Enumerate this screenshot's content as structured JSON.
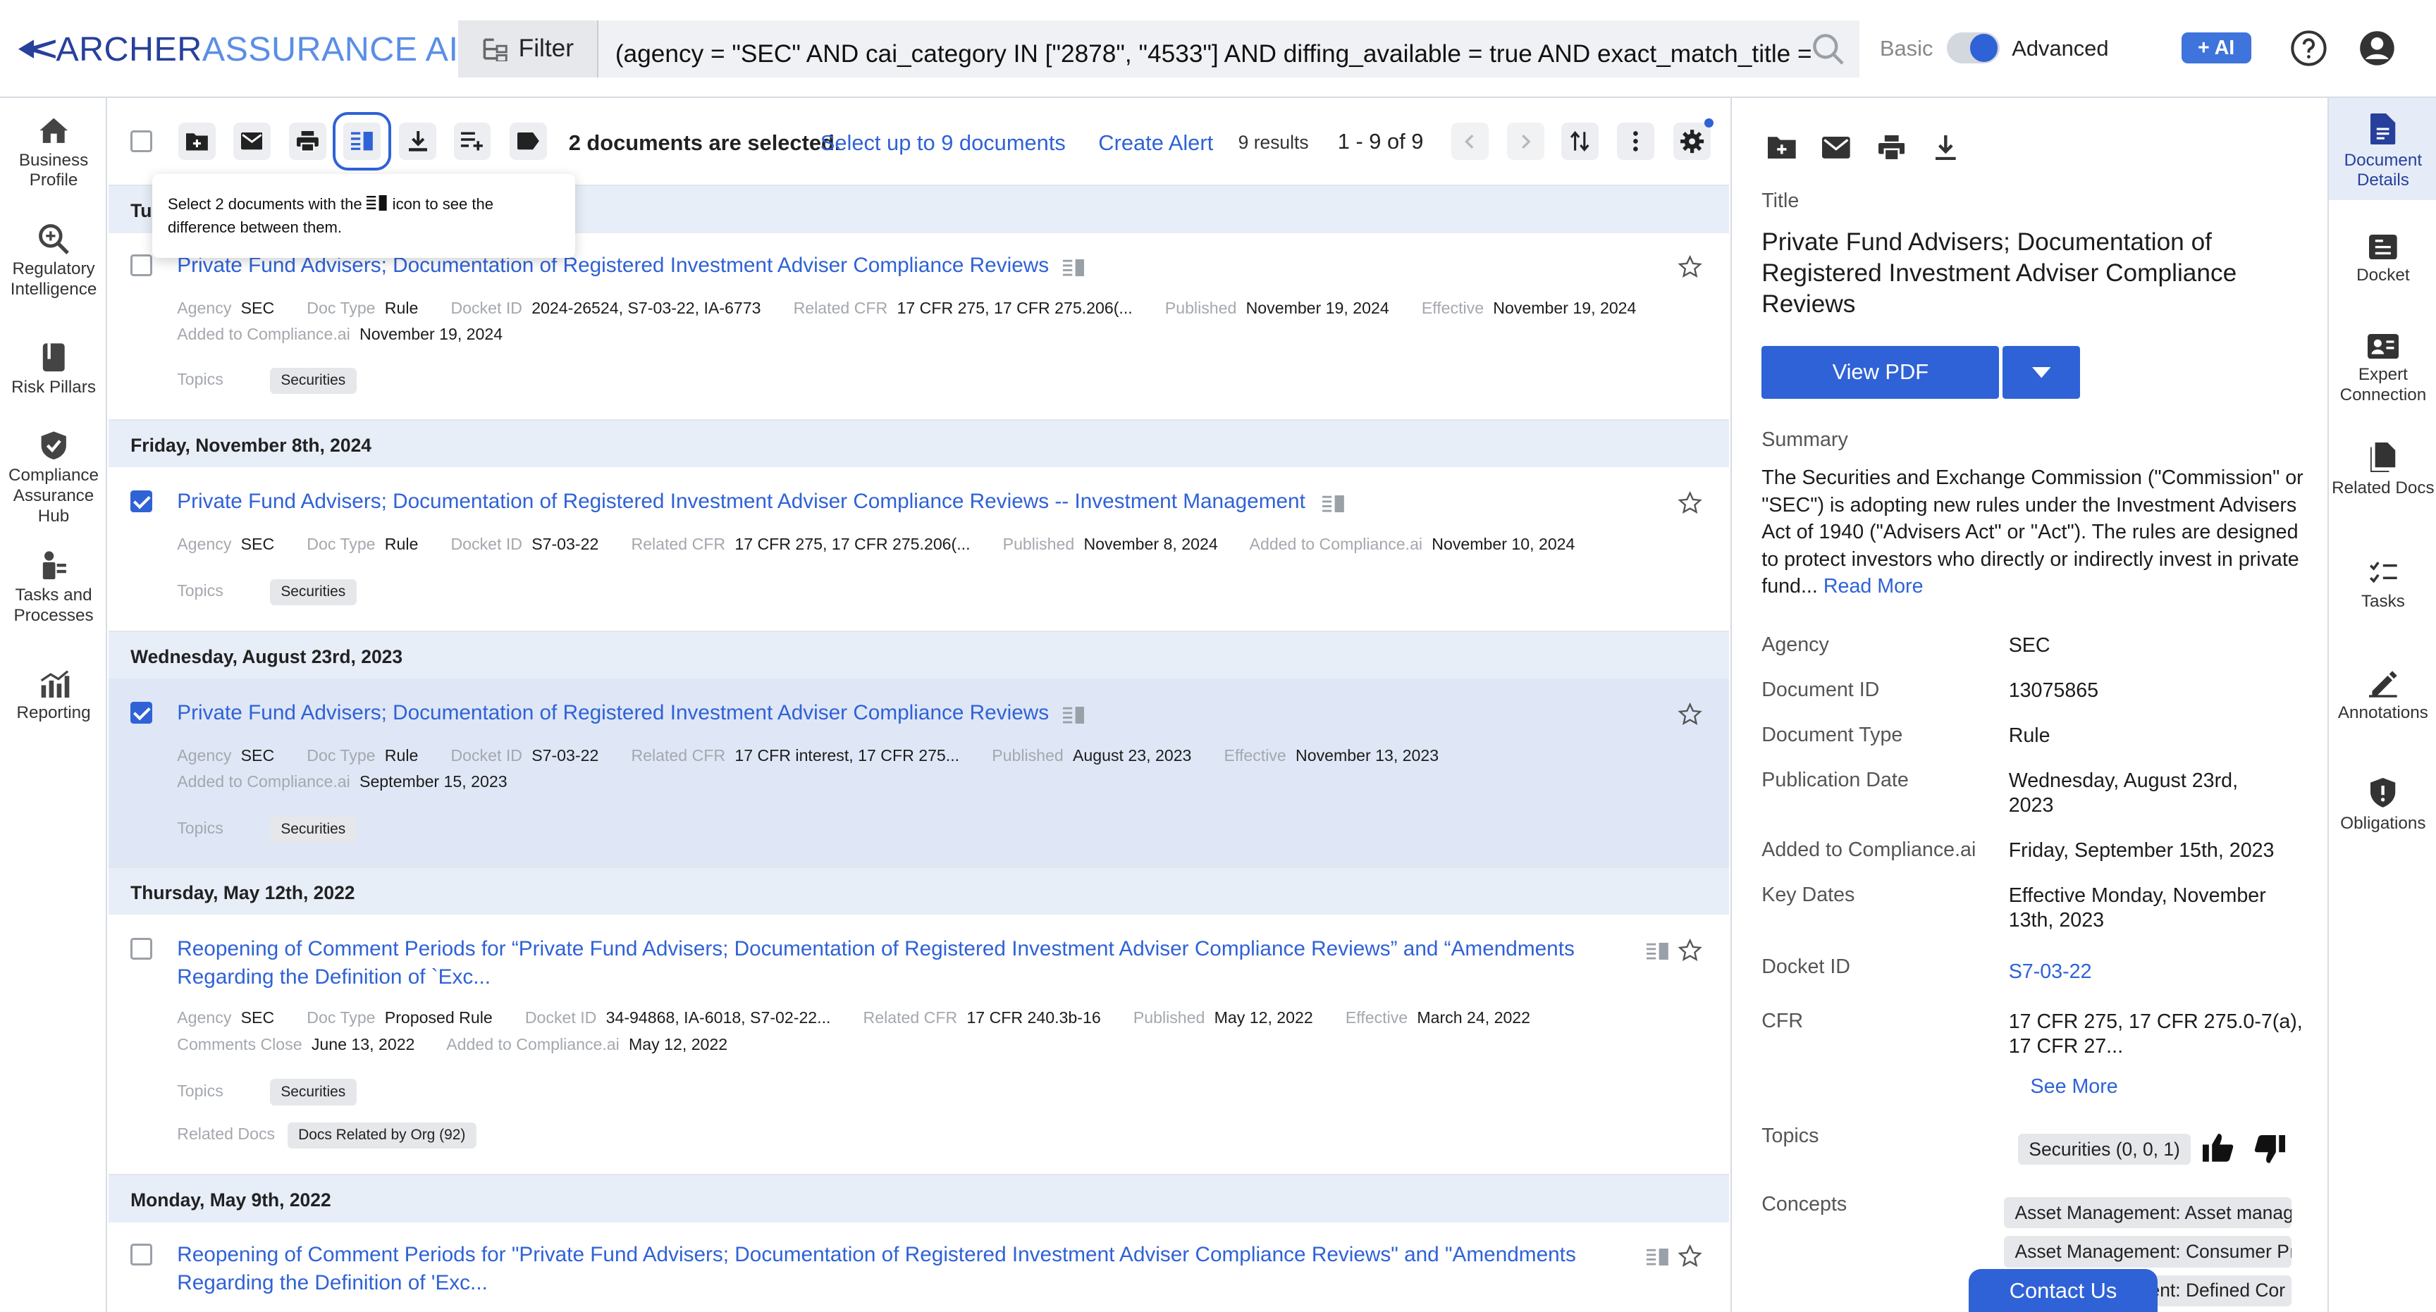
{
  "app": {
    "logo_part1": "ARCHER",
    "logo_part2": "ASSURANCE AI"
  },
  "header": {
    "filter_label": "Filter",
    "query": "(agency = \"SEC\" AND cai_category IN [\"2878\", \"4533\"] AND diffing_available = true AND exact_match_title =",
    "mode_basic": "Basic",
    "mode_advanced": "Advanced",
    "ai_label": "+ AI",
    "advanced_enabled": true
  },
  "leftnav": [
    {
      "label": "Business Profile",
      "icon": "house-icon"
    },
    {
      "label": "Regulatory Intelligence",
      "icon": "magnify-icon"
    },
    {
      "label": "Risk Pillars",
      "icon": "book-icon"
    },
    {
      "label": "Compliance Assurance Hub",
      "icon": "shield-check-icon"
    },
    {
      "label": "Tasks and Processes",
      "icon": "tasks-icon"
    },
    {
      "label": "Reporting",
      "icon": "chart-icon"
    }
  ],
  "toolbar": {
    "selected_text": "2 documents are selected.",
    "select_up_to": "Select up to 9 documents",
    "create_alert": "Create Alert",
    "results": "9 results",
    "range": "1 - 9 of 9"
  },
  "tooltip": {
    "text_before": "Select 2 documents with the",
    "text_after": "icon to see the difference between them."
  },
  "list": {
    "first_date_fragment": "Tu",
    "dates": [
      "Friday, November 8th, 2024",
      "Wednesday, August 23rd, 2023",
      "Thursday, May 12th, 2022",
      "Monday, May 9th, 2022"
    ],
    "docs": [
      {
        "title": "Private Fund Advisers; Documentation of Registered Investment Adviser Compliance Reviews",
        "checked": false,
        "meta1": [
          {
            "k": "Agency",
            "v": "SEC"
          },
          {
            "k": "Doc Type",
            "v": "Rule"
          },
          {
            "k": "Docket ID",
            "v": "2024-26524, S7-03-22, IA-6773"
          },
          {
            "k": "Related CFR",
            "v": "17 CFR 275, 17 CFR 275.206(..."
          },
          {
            "k": "Published",
            "v": "November 19, 2024"
          },
          {
            "k": "Effective",
            "v": "November 19, 2024"
          }
        ],
        "meta2": [
          {
            "k": "Added to Compliance.ai",
            "v": "November 19, 2024"
          }
        ],
        "topics_label": "Topics",
        "topic": "Securities"
      },
      {
        "title": "Private Fund Advisers; Documentation of Registered Investment Adviser Compliance Reviews -- Investment Management",
        "checked": true,
        "meta1": [
          {
            "k": "Agency",
            "v": "SEC"
          },
          {
            "k": "Doc Type",
            "v": "Rule"
          },
          {
            "k": "Docket ID",
            "v": "S7-03-22"
          },
          {
            "k": "Related CFR",
            "v": "17 CFR 275, 17 CFR 275.206(..."
          },
          {
            "k": "Published",
            "v": "November 8, 2024"
          },
          {
            "k": "Added to Compliance.ai",
            "v": "November 10, 2024"
          }
        ],
        "topics_label": "Topics",
        "topic": "Securities"
      },
      {
        "title": "Private Fund Advisers; Documentation of Registered Investment Adviser Compliance Reviews",
        "checked": true,
        "meta1": [
          {
            "k": "Agency",
            "v": "SEC"
          },
          {
            "k": "Doc Type",
            "v": "Rule"
          },
          {
            "k": "Docket ID",
            "v": "S7-03-22"
          },
          {
            "k": "Related CFR",
            "v": "17 CFR interest, 17 CFR 275..."
          },
          {
            "k": "Published",
            "v": "August 23, 2023"
          },
          {
            "k": "Effective",
            "v": "November 13, 2023"
          }
        ],
        "meta2": [
          {
            "k": "Added to Compliance.ai",
            "v": "September 15, 2023"
          }
        ],
        "topics_label": "Topics",
        "topic": "Securities"
      },
      {
        "title": "Reopening of Comment Periods for “Private Fund Advisers; Documentation of Registered Investment Adviser Compliance Reviews” and “Amendments Regarding the Definition of `Exc...",
        "checked": false,
        "meta1": [
          {
            "k": "Agency",
            "v": "SEC"
          },
          {
            "k": "Doc Type",
            "v": "Proposed Rule"
          },
          {
            "k": "Docket ID",
            "v": "34-94868, IA-6018, S7-02-22..."
          },
          {
            "k": "Related CFR",
            "v": "17 CFR 240.3b-16"
          },
          {
            "k": "Published",
            "v": "May 12, 2022"
          },
          {
            "k": "Effective",
            "v": "March 24, 2022"
          }
        ],
        "meta2": [
          {
            "k": "Comments Close",
            "v": "June 13, 2022"
          },
          {
            "k": "Added to Compliance.ai",
            "v": "May 12, 2022"
          }
        ],
        "topics_label": "Topics",
        "topic": "Securities",
        "related_label": "Related Docs",
        "related": "Docs Related by Org (92)"
      },
      {
        "title": "Reopening of Comment Periods for \"Private Fund Advisers; Documentation of Registered Investment Adviser Compliance Reviews\" and \"Amendments Regarding the Definition of 'Exc...",
        "checked": false
      }
    ]
  },
  "detail": {
    "title_label": "Title",
    "title": "Private Fund Advisers; Documentation of Registered Investment Adviser Compliance Reviews",
    "view_pdf": "View PDF",
    "summary_label": "Summary",
    "summary": "The Securities and Exchange Commission (\"Commission\" or \"SEC\") is adopting new rules under the Investment Advisers Act of 1940 (\"Advisers Act\" or \"Act\"). The rules are designed to protect investors who directly or indirectly invest in private fund...",
    "read_more": "Read More",
    "fields": [
      {
        "label": "Agency",
        "value": "SEC"
      },
      {
        "label": "Document ID",
        "value": "13075865"
      },
      {
        "label": "Document Type",
        "value": "Rule"
      },
      {
        "label": "Publication Date",
        "value": "Wednesday, August 23rd, 2023"
      },
      {
        "label": "Added to Compliance.ai",
        "value": "Friday, September 15th, 2023"
      },
      {
        "label": "Key Dates",
        "value": "Effective Monday, November 13th, 2023"
      },
      {
        "label": "Docket ID",
        "value": "S7-03-22"
      },
      {
        "label": "CFR",
        "value": "17 CFR 275, 17 CFR 275.0-7(a), 17 CFR 27..."
      }
    ],
    "see_more": "See More",
    "topics_label": "Topics",
    "topic_value": "Securities (0, 0, 1)",
    "concepts_label": "Concepts",
    "concepts": [
      "Asset Management: Asset manag",
      "Asset Management: Consumer Pı",
      "Asset Management: Defined Cor"
    ]
  },
  "rail": [
    {
      "label": "Document Details",
      "icon": "document-icon"
    },
    {
      "label": "Docket",
      "icon": "docket-icon"
    },
    {
      "label": "Expert Connection",
      "icon": "id-card-icon"
    },
    {
      "label": "Related Docs",
      "icon": "related-docs-icon"
    },
    {
      "label": "Tasks",
      "icon": "checklist-icon"
    },
    {
      "label": "Annotations",
      "icon": "pen-icon"
    },
    {
      "label": "Obligations",
      "icon": "shield-alert-icon"
    }
  ],
  "contact_us": "Contact Us",
  "colors": {
    "accent": "#2f62d6",
    "logo_dark": "#27409c",
    "logo_light": "#5a8ee6",
    "selected_row": "#dfe7f6",
    "date_row": "#e8eef8"
  }
}
